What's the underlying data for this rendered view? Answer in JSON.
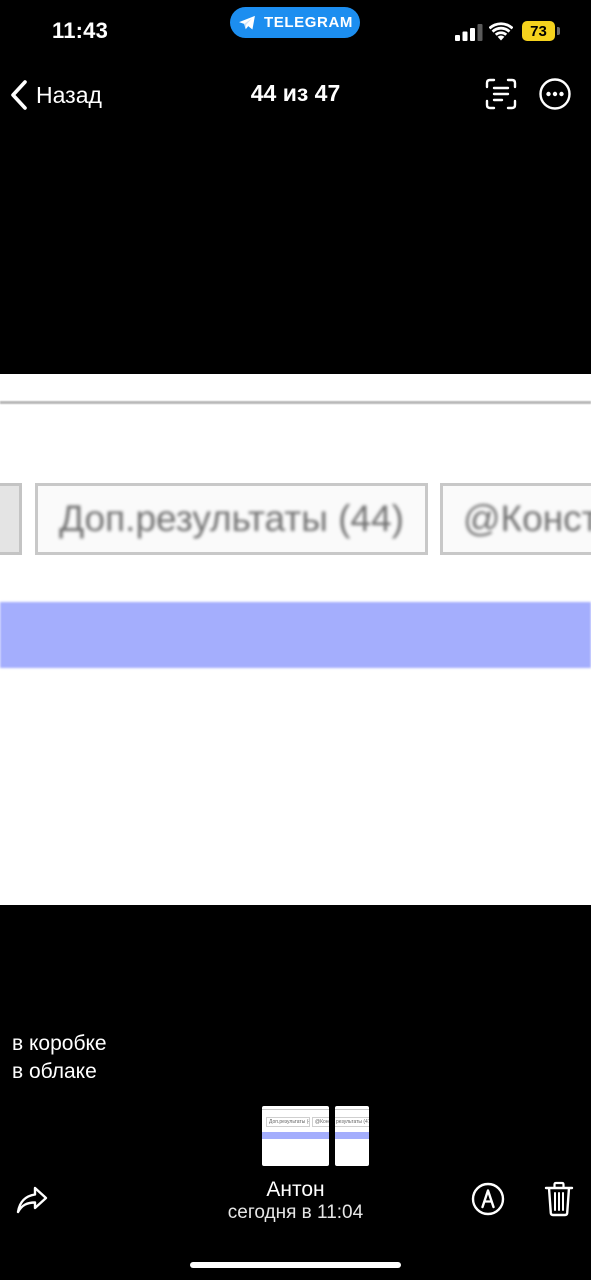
{
  "status_bar": {
    "time": "11:43",
    "telegram_label": "TELEGRAM",
    "battery_level": "73",
    "battery_color": "#f5d21d",
    "pill_color": "#1c8ef0"
  },
  "nav": {
    "back_label": "Назад",
    "counter": "44 из 47",
    "icons": [
      "chevron-left-icon",
      "live-text-icon",
      "more-icon"
    ]
  },
  "photo": {
    "button_label": "Доп.результаты (44)",
    "partial_label": "@Конст",
    "band_color": "#a4aefd"
  },
  "caption": {
    "line1": "в коробке",
    "line2": "в облаке"
  },
  "thumbnails": [
    {
      "label": "Доп.результаты (44)",
      "partial": "@Конс"
    },
    {
      "label": "результаты (47"
    }
  ],
  "footer": {
    "author": "Антон",
    "date": "сегодня в 11:04",
    "icons": [
      "share-icon",
      "markup-icon",
      "trash-icon"
    ]
  }
}
